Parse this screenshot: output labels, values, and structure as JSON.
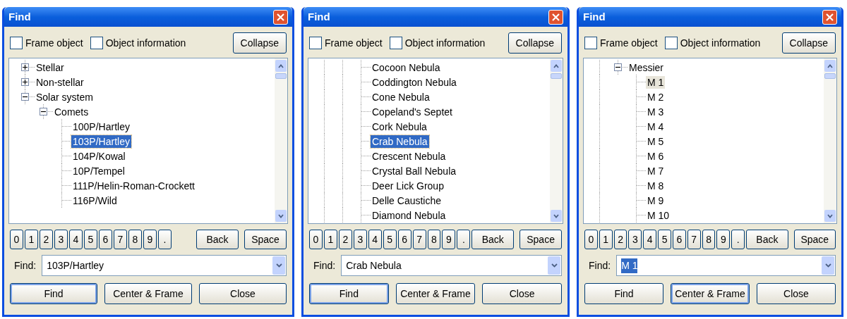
{
  "dialogs": [
    {
      "title": "Find",
      "checkboxes": [
        {
          "label": "Frame object",
          "checked": false
        },
        {
          "label": "Object information",
          "checked": false
        }
      ],
      "collapse_button": "Collapse",
      "tree": {
        "focused": true,
        "kind": "root",
        "items": [
          {
            "label": "Stellar",
            "expanded": false,
            "selected": false
          },
          {
            "label": "Non-stellar",
            "expanded": false,
            "selected": false
          },
          {
            "label": "Solar system",
            "expanded": true,
            "selected": false,
            "children": [
              {
                "label": "Comets",
                "expanded": true,
                "selected": false,
                "children": [
                  {
                    "label": "100P/Hartley",
                    "selected": false
                  },
                  {
                    "label": "103P/Hartley",
                    "selected": true
                  },
                  {
                    "label": "104P/Kowal",
                    "selected": false
                  },
                  {
                    "label": "10P/Tempel",
                    "selected": false
                  },
                  {
                    "label": "111P/Helin-Roman-Crockett",
                    "selected": false
                  },
                  {
                    "label": "116P/Wild",
                    "selected": false
                  }
                ]
              }
            ]
          }
        ]
      },
      "keypad": [
        "0",
        "1",
        "2",
        "3",
        "4",
        "5",
        "6",
        "7",
        "8",
        "9",
        "."
      ],
      "back_button": "Back",
      "space_button": "Space",
      "find_label": "Find:",
      "find_field": {
        "value": "103P/Hartley",
        "value_selected": false
      },
      "buttons": [
        {
          "label": "Find",
          "default": true
        },
        {
          "label": "Center & Frame",
          "default": false
        },
        {
          "label": "Close",
          "default": false
        }
      ]
    },
    {
      "title": "Find",
      "checkboxes": [
        {
          "label": "Frame object",
          "checked": false
        },
        {
          "label": "Object information",
          "checked": false
        }
      ],
      "collapse_button": "Collapse",
      "tree": {
        "focused": true,
        "kind": "deep",
        "items": [
          {
            "label": "Cocoon Nebula",
            "selected": false
          },
          {
            "label": "Coddington Nebula",
            "selected": false
          },
          {
            "label": "Cone Nebula",
            "selected": false
          },
          {
            "label": "Copeland's Septet",
            "selected": false
          },
          {
            "label": "Cork Nebula",
            "selected": false
          },
          {
            "label": "Crab Nebula",
            "selected": true
          },
          {
            "label": "Crescent Nebula",
            "selected": false
          },
          {
            "label": "Crystal Ball Nebula",
            "selected": false
          },
          {
            "label": "Deer Lick Group",
            "selected": false
          },
          {
            "label": "Delle Caustiche",
            "selected": false
          },
          {
            "label": "Diamond Nebula",
            "selected": false
          }
        ]
      },
      "keypad": [
        "0",
        "1",
        "2",
        "3",
        "4",
        "5",
        "6",
        "7",
        "8",
        "9",
        "."
      ],
      "back_button": "Back",
      "space_button": "Space",
      "find_label": "Find:",
      "find_field": {
        "value": "Crab Nebula",
        "value_selected": false
      },
      "buttons": [
        {
          "label": "Find",
          "default": true
        },
        {
          "label": "Center & Frame",
          "default": false
        },
        {
          "label": "Close",
          "default": false
        }
      ]
    },
    {
      "title": "Find",
      "checkboxes": [
        {
          "label": "Frame object",
          "checked": false
        },
        {
          "label": "Object information",
          "checked": false
        }
      ],
      "collapse_button": "Collapse",
      "tree": {
        "focused": false,
        "kind": "mid",
        "items": [
          {
            "label": "Messier",
            "expanded": true,
            "selected": false,
            "children": [
              {
                "label": "M 1",
                "selected": true
              },
              {
                "label": "M 2",
                "selected": false
              },
              {
                "label": "M 3",
                "selected": false
              },
              {
                "label": "M 4",
                "selected": false
              },
              {
                "label": "M 5",
                "selected": false
              },
              {
                "label": "M 6",
                "selected": false
              },
              {
                "label": "M 7",
                "selected": false
              },
              {
                "label": "M 8",
                "selected": false
              },
              {
                "label": "M 9",
                "selected": false
              },
              {
                "label": "M 10",
                "selected": false
              }
            ]
          }
        ]
      },
      "keypad": [
        "0",
        "1",
        "2",
        "3",
        "4",
        "5",
        "6",
        "7",
        "8",
        "9",
        "."
      ],
      "back_button": "Back",
      "space_button": "Space",
      "find_label": "Find:",
      "find_field": {
        "value": "M 1",
        "value_selected": true
      },
      "buttons": [
        {
          "label": "Find",
          "default": false
        },
        {
          "label": "Center & Frame",
          "default": true
        },
        {
          "label": "Close",
          "default": false
        }
      ]
    }
  ]
}
